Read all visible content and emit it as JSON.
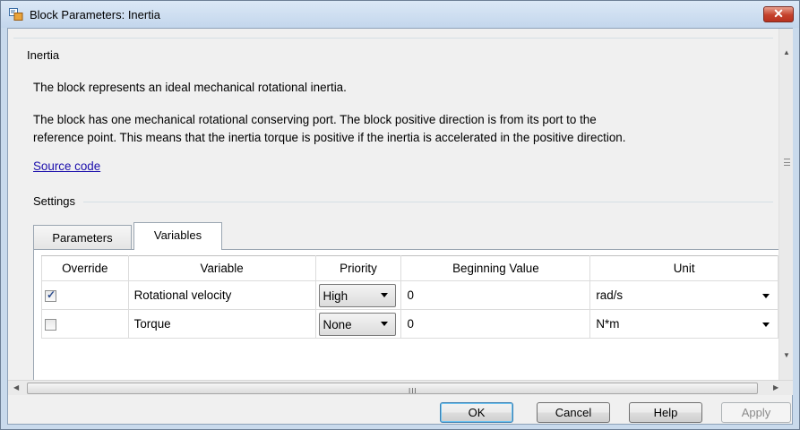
{
  "window": {
    "title": "Block Parameters: Inertia",
    "close_label": "✕"
  },
  "description": {
    "group_title": "Inertia",
    "line1": "The block represents an ideal mechanical rotational inertia.",
    "line2": "The block has one mechanical rotational conserving port. The block positive direction is from its port to the",
    "line3": "reference point. This means that the inertia torque is positive if the inertia is accelerated in the positive direction.",
    "source_link": "Source code"
  },
  "settings": {
    "title": "Settings",
    "tabs": [
      {
        "label": "Parameters",
        "active": false
      },
      {
        "label": "Variables",
        "active": true
      }
    ],
    "columns": [
      "Override",
      "Variable",
      "Priority",
      "Beginning Value",
      "Unit"
    ],
    "rows": [
      {
        "override": true,
        "variable": "Rotational velocity",
        "priority": "High",
        "beginning_value": "0",
        "unit": "rad/s"
      },
      {
        "override": false,
        "variable": "Torque",
        "priority": "None",
        "beginning_value": "0",
        "unit": "N*m"
      }
    ]
  },
  "buttons": {
    "ok": "OK",
    "cancel": "Cancel",
    "help": "Help",
    "apply": "Apply"
  },
  "colors": {
    "accent": "#3c7fb1",
    "link": "#1a0dab",
    "close_button": "#c4412b"
  }
}
